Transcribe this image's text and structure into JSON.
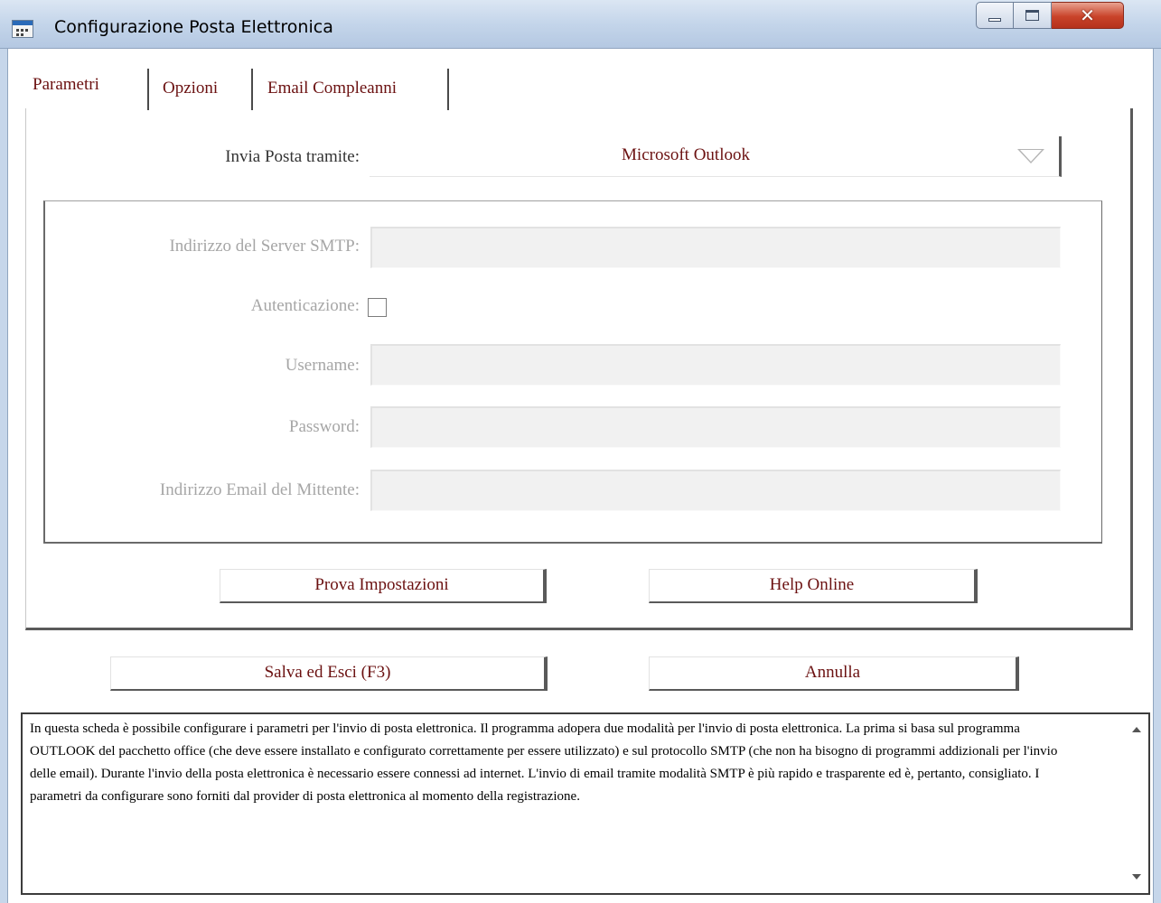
{
  "window": {
    "title": "Configurazione Posta Elettronica",
    "controls": {
      "minimize": "minimize-icon",
      "maximize": "maximize-icon",
      "close": "close-icon"
    }
  },
  "tabs": [
    {
      "label": "Parametri",
      "active": true
    },
    {
      "label": "Opzioni",
      "active": false
    },
    {
      "label": "Email Compleanni",
      "active": false
    }
  ],
  "send_via": {
    "label": "Invia Posta tramite:",
    "value": "Microsoft Outlook"
  },
  "smtp": {
    "server_label": "Indirizzo del Server SMTP:",
    "server_value": "",
    "auth_label": "Autenticazione:",
    "auth_checked": false,
    "username_label": "Username:",
    "username_value": "",
    "password_label": "Password:",
    "password_value": "",
    "sender_label": "Indirizzo Email del Mittente:",
    "sender_value": ""
  },
  "buttons": {
    "test": "Prova Impostazioni",
    "help": "Help Online",
    "save": "Salva ed Esci  (F3)",
    "cancel": "Annulla"
  },
  "description": "In questa scheda è possibile configurare i parametri per l'invio di posta elettronica. Il programma adopera due modalità per l'invio di posta elettronica. La prima si basa sul programma OUTLOOK del pacchetto office (che deve essere installato e configurato correttamente per essere utilizzato) e sul protocollo SMTP (che non ha bisogno di programmi addizionali per l'invio delle email). Durante l'invio della posta elettronica è necessario essere connessi ad internet. L'invio di email tramite modalità SMTP è più rapido e trasparente ed è, pertanto, consigliato. I parametri da configurare sono forniti dal provider di posta elettronica al momento della registrazione.",
  "colors": {
    "accent_text": "#6b1111",
    "disabled_text": "#a6a6a6",
    "titlebar": "#c4d5ea",
    "close_button": "#c9432a"
  }
}
